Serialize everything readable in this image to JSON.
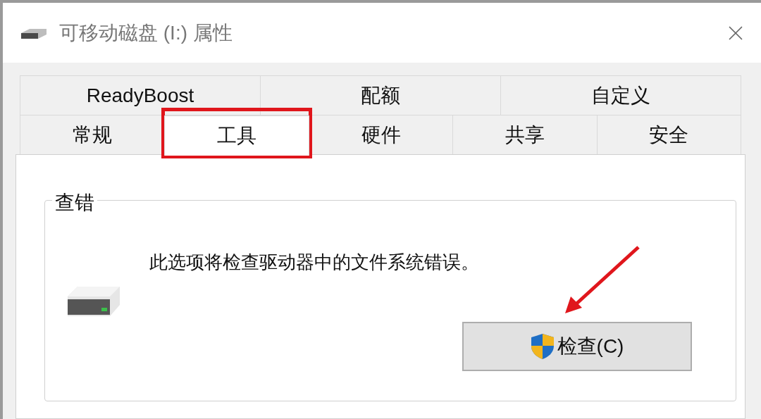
{
  "window": {
    "title": "可移动磁盘 (I:) 属性"
  },
  "tab_rows": [
    [
      {
        "label": "ReadyBoost",
        "selected": false
      },
      {
        "label": "配额",
        "selected": false
      },
      {
        "label": "自定义",
        "selected": false
      }
    ],
    [
      {
        "label": "常规",
        "selected": false
      },
      {
        "label": "工具",
        "selected": true
      },
      {
        "label": "硬件",
        "selected": false
      },
      {
        "label": "共享",
        "selected": false
      },
      {
        "label": "安全",
        "selected": false
      }
    ]
  ],
  "group": {
    "title": "查错",
    "description": "此选项将检查驱动器中的文件系统错误。",
    "button": "检查(C)"
  }
}
